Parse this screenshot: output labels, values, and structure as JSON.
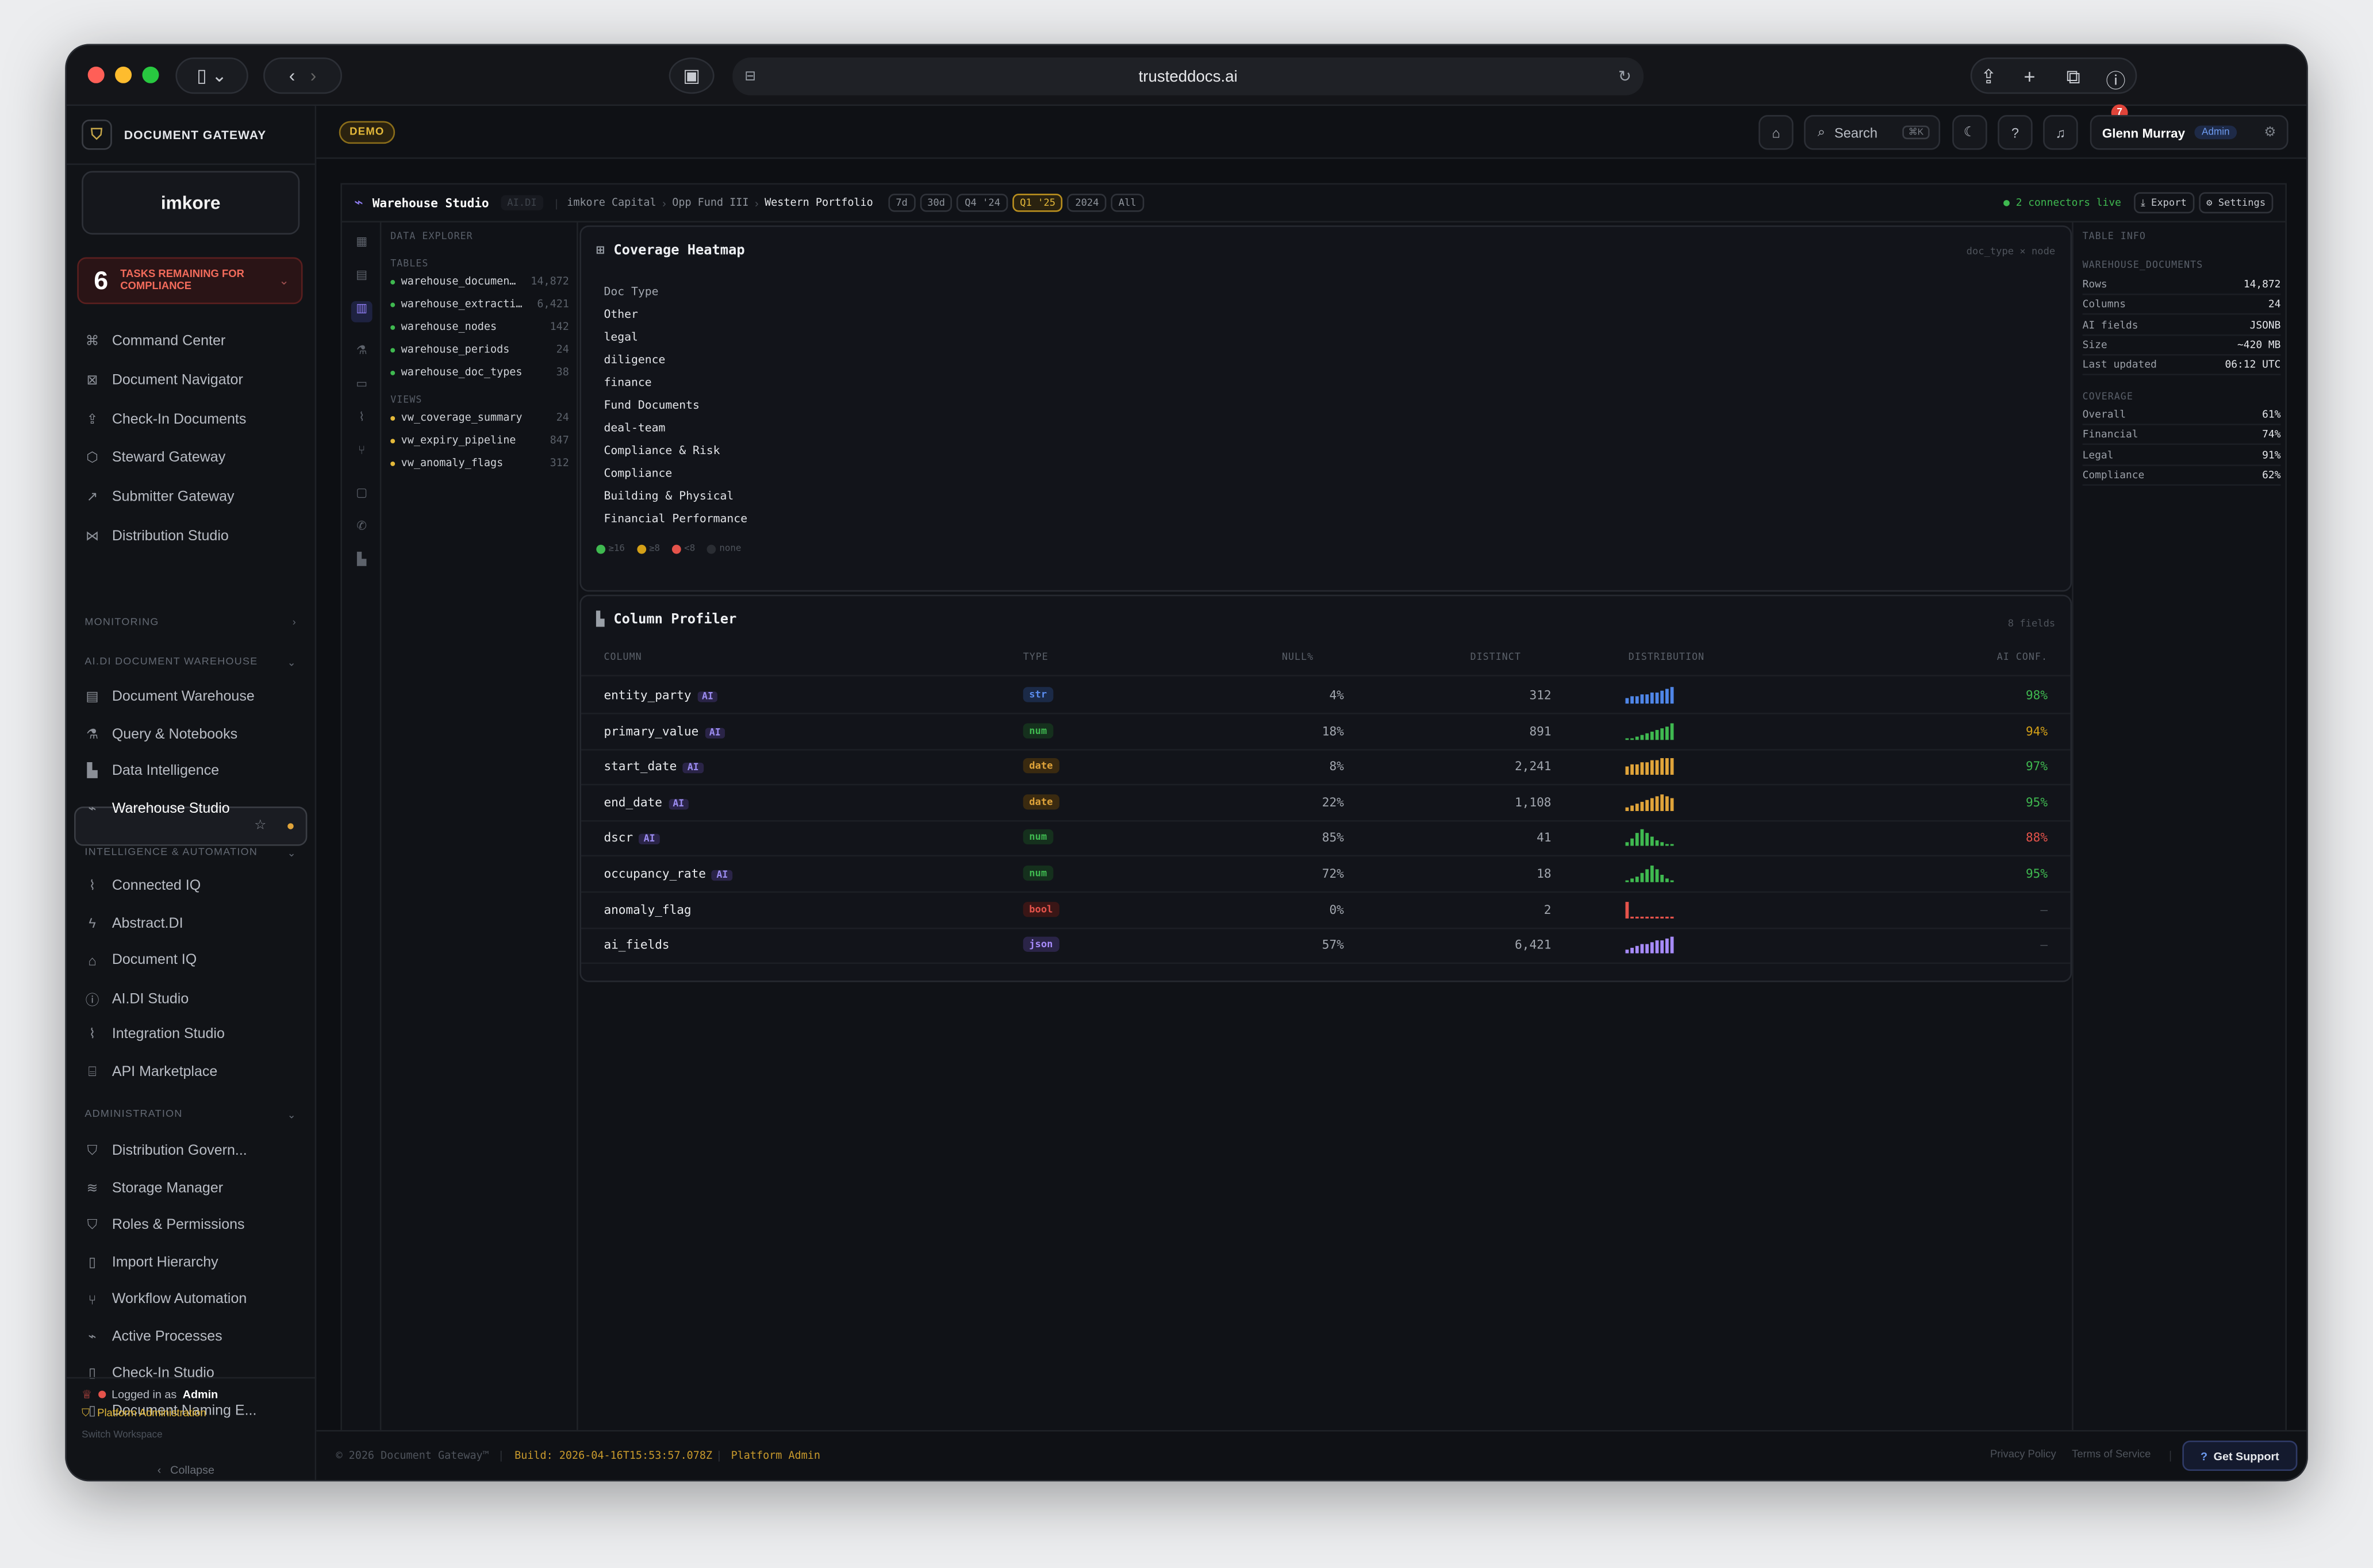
{
  "browser": {
    "url": "trusteddocs.ai"
  },
  "brand": {
    "name": "DOCUMENT GATEWAY",
    "logo": "imkore"
  },
  "tasks": {
    "count": "6",
    "label": "TASKS REMAINING FOR COMPLIANCE"
  },
  "nav_main": [
    {
      "label": "Command Center",
      "icon": "command-icon"
    },
    {
      "label": "Document Navigator",
      "icon": "navigator-icon"
    },
    {
      "label": "Check-In Documents",
      "icon": "upload-icon"
    },
    {
      "label": "Steward Gateway",
      "icon": "cube-icon"
    },
    {
      "label": "Submitter Gateway",
      "icon": "external-link-icon"
    },
    {
      "label": "Distribution Studio",
      "icon": "share-icon"
    }
  ],
  "sections": {
    "monitoring": "MONITORING",
    "warehouse": "AI.DI DOCUMENT WAREHOUSE",
    "intelligence": "INTELLIGENCE & AUTOMATION",
    "admin": "ADMINISTRATION"
  },
  "nav_warehouse": [
    {
      "label": "Document Warehouse",
      "icon": "database-icon"
    },
    {
      "label": "Query & Notebooks",
      "icon": "flask-icon"
    },
    {
      "label": "Data Intelligence",
      "icon": "bar-chart-icon"
    },
    {
      "label": "Warehouse Studio",
      "icon": "activity-icon"
    }
  ],
  "nav_intel": [
    {
      "label": "Connected IQ",
      "icon": "plug-icon"
    },
    {
      "label": "Abstract.DI",
      "icon": "bolt-icon"
    },
    {
      "label": "Document IQ",
      "icon": "robot-icon"
    },
    {
      "label": "AI.DI Studio",
      "icon": "info-icon"
    },
    {
      "label": "Integration Studio",
      "icon": "plug-icon"
    },
    {
      "label": "API Marketplace",
      "icon": "store-icon"
    }
  ],
  "nav_admin": [
    {
      "label": "Distribution Govern...",
      "icon": "shield-icon"
    },
    {
      "label": "Storage Manager",
      "icon": "layers-icon"
    },
    {
      "label": "Roles & Permissions",
      "icon": "shield-icon"
    },
    {
      "label": "Import Hierarchy",
      "icon": "file-icon"
    },
    {
      "label": "Workflow Automation",
      "icon": "branch-icon"
    },
    {
      "label": "Active Processes",
      "icon": "activity-icon"
    },
    {
      "label": "Check-In Studio",
      "icon": "file-icon"
    },
    {
      "label": "Document Naming E...",
      "icon": "file-icon"
    }
  ],
  "sidebar_footer": {
    "logged_prefix": "Logged in as",
    "logged_user": "Admin",
    "platform": "Platform Administration",
    "switch": "Switch Workspace",
    "collapse": "Collapse"
  },
  "header": {
    "demo": "DEMO",
    "search": "Search",
    "search_kbd": "⌘K",
    "notifications": "7",
    "user": "Glenn Murray",
    "role": "Admin"
  },
  "topbar": {
    "title": "Warehouse Studio",
    "tag": "AI.DI",
    "crumbs": [
      "imkore Capital",
      "Opp Fund III",
      "Western Portfolio"
    ],
    "periods": [
      "7d",
      "30d",
      "Q4 '24",
      "Q1 '25",
      "2024",
      "All"
    ],
    "active_period": "Q1 '25",
    "connectors": "2 connectors live",
    "export": "Export",
    "settings": "Settings"
  },
  "explorer": {
    "title": "DATA EXPLORER",
    "tables_label": "TABLES",
    "tables": [
      {
        "name": "warehouse_documen…",
        "count": "14,872"
      },
      {
        "name": "warehouse_extracti…",
        "count": "6,421"
      },
      {
        "name": "warehouse_nodes",
        "count": "142"
      },
      {
        "name": "warehouse_periods",
        "count": "24"
      },
      {
        "name": "warehouse_doc_types",
        "count": "38"
      }
    ],
    "views_label": "VIEWS",
    "views": [
      {
        "name": "vw_coverage_summary",
        "count": "24"
      },
      {
        "name": "vw_expiry_pipeline",
        "count": "847"
      },
      {
        "name": "vw_anomaly_flags",
        "count": "312"
      }
    ]
  },
  "heatmap": {
    "title": "Coverage Heatmap",
    "subtitle": "doc_type × node",
    "header": "Doc Type",
    "rows": [
      "Other",
      "legal",
      "diligence",
      "finance",
      "Fund Documents",
      "deal-team",
      "Compliance & Risk",
      "Compliance",
      "Building & Physical",
      "Financial Performance"
    ],
    "legend": [
      {
        "label": "≥16",
        "color": "#3fb950"
      },
      {
        "label": "≥8",
        "color": "#d4a017"
      },
      {
        "label": "<8",
        "color": "#e5534b"
      },
      {
        "label": "none",
        "color": "#2a2d33"
      }
    ]
  },
  "profiler": {
    "title": "Column Profiler",
    "subtitle": "8 fields",
    "columns": [
      "COLUMN",
      "TYPE",
      "NULL%",
      "DISTINCT",
      "DISTRIBUTION",
      "AI CONF."
    ],
    "rows": [
      {
        "name": "entity_party",
        "ai": true,
        "type": "str",
        "null": "4%",
        "distinct": "312",
        "conf": "98%",
        "conf_color": "#3fb950",
        "type_color": "#5b8def",
        "type_bg": "#1b2a47",
        "bar_color": "#4f86e8",
        "bars": [
          3,
          4,
          4,
          5,
          5,
          6,
          6,
          7,
          8,
          9
        ]
      },
      {
        "name": "primary_value",
        "ai": true,
        "type": "num",
        "null": "18%",
        "distinct": "891",
        "conf": "94%",
        "conf_color": "#d4a017",
        "type_color": "#3fb950",
        "type_bg": "#15301d",
        "bar_color": "#3fb950",
        "bars": [
          1,
          1,
          2,
          3,
          4,
          5,
          6,
          7,
          8,
          10
        ]
      },
      {
        "name": "start_date",
        "ai": true,
        "type": "date",
        "null": "8%",
        "distinct": "2,241",
        "conf": "97%",
        "conf_color": "#3fb950",
        "type_color": "#e0a43a",
        "type_bg": "#3a2a10",
        "bar_color": "#e0a43a",
        "bars": [
          4,
          5,
          5,
          6,
          6,
          7,
          7,
          8,
          8,
          8
        ]
      },
      {
        "name": "end_date",
        "ai": true,
        "type": "date",
        "null": "22%",
        "distinct": "1,108",
        "conf": "95%",
        "conf_color": "#3fb950",
        "type_color": "#e0a43a",
        "type_bg": "#3a2a10",
        "bar_color": "#e0a43a",
        "bars": [
          2,
          3,
          4,
          5,
          6,
          7,
          8,
          9,
          8,
          7
        ]
      },
      {
        "name": "dscr",
        "ai": true,
        "type": "num",
        "null": "85%",
        "distinct": "41",
        "conf": "88%",
        "conf_color": "#e5534b",
        "type_color": "#3fb950",
        "type_bg": "#15301d",
        "bar_color": "#3fb950",
        "bars": [
          2,
          4,
          7,
          9,
          7,
          5,
          3,
          2,
          1,
          1
        ]
      },
      {
        "name": "occupancy_rate",
        "ai": true,
        "type": "num",
        "null": "72%",
        "distinct": "18",
        "conf": "95%",
        "conf_color": "#3fb950",
        "type_color": "#3fb950",
        "type_bg": "#15301d",
        "bar_color": "#3fb950",
        "bars": [
          1,
          2,
          3,
          5,
          7,
          9,
          7,
          4,
          2,
          1
        ]
      },
      {
        "name": "anomaly_flag",
        "ai": false,
        "type": "bool",
        "null": "0%",
        "distinct": "2",
        "conf": "—",
        "conf_color": "#4a4f57",
        "type_color": "#e5534b",
        "type_bg": "#3a1616",
        "bar_color": "#e5534b",
        "bars": [
          9,
          1,
          1,
          1,
          1,
          1,
          1,
          1,
          1,
          1
        ]
      },
      {
        "name": "ai_fields",
        "ai": false,
        "type": "json",
        "null": "57%",
        "distinct": "6,421",
        "conf": "—",
        "conf_color": "#4a4f57",
        "type_color": "#a78bfa",
        "type_bg": "#2a2447",
        "bar_color": "#a78bfa",
        "bars": [
          2,
          3,
          4,
          5,
          5,
          6,
          7,
          7,
          8,
          9
        ]
      }
    ]
  },
  "tableinfo": {
    "title": "TABLE INFO",
    "name": "WAREHOUSE_DOCUMENTS",
    "rows": [
      {
        "k": "Rows",
        "v": "14,872"
      },
      {
        "k": "Columns",
        "v": "24"
      },
      {
        "k": "AI fields",
        "v": "JSONB"
      },
      {
        "k": "Size",
        "v": "~420 MB"
      },
      {
        "k": "Last updated",
        "v": "06:12 UTC"
      }
    ],
    "coverage_label": "COVERAGE",
    "coverage": [
      {
        "k": "Overall",
        "v": "61%"
      },
      {
        "k": "Financial",
        "v": "74%"
      },
      {
        "k": "Legal",
        "v": "91%"
      },
      {
        "k": "Compliance",
        "v": "62%"
      }
    ]
  },
  "footer": {
    "copyright": "© 2026 Document Gateway™",
    "build": "Build: 2026-04-16T15:53:57.078Z",
    "platform": "Platform Admin",
    "privacy": "Privacy Policy",
    "terms": "Terms of Service",
    "support": "Get Support"
  }
}
